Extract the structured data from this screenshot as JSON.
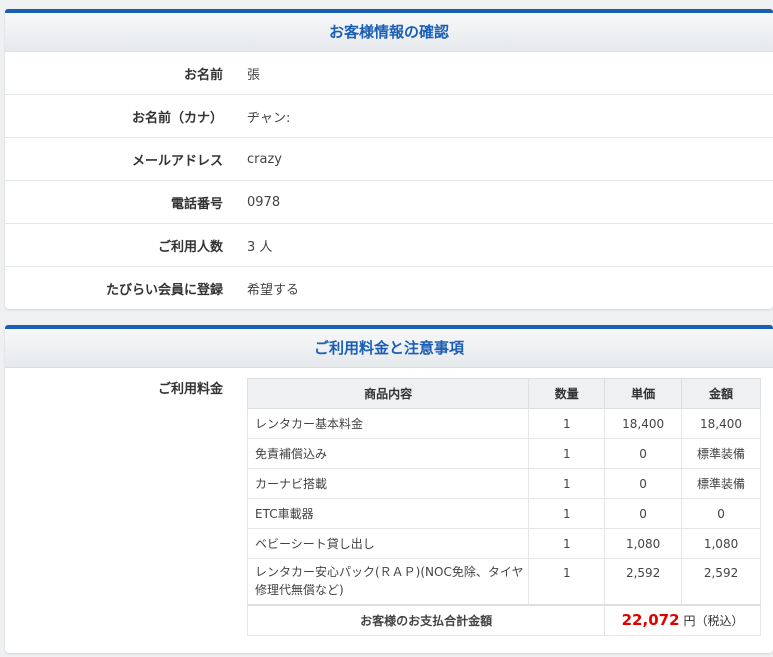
{
  "customer": {
    "title": "お客様情報の確認",
    "rows": [
      {
        "label": "お名前",
        "value": "張"
      },
      {
        "label": "お名前（カナ）",
        "value": "ヂャン:"
      },
      {
        "label": "メールアドレス",
        "value": "crazy"
      },
      {
        "label": "電話番号",
        "value": "0978"
      },
      {
        "label": "ご利用人数",
        "value": "3 人"
      },
      {
        "label": "たびらい会員に登録",
        "value": "希望する"
      }
    ]
  },
  "fees": {
    "title": "ご利用料金と注意事項",
    "label": "ご利用料金",
    "headers": {
      "item": "商品内容",
      "qty": "数量",
      "unit": "単価",
      "amount": "金額"
    },
    "items": [
      {
        "name": "レンタカー基本料金",
        "qty": "1",
        "unit": "18,400",
        "amount": "18,400"
      },
      {
        "name": "免責補償込み",
        "qty": "1",
        "unit": "0",
        "amount": "標準装備"
      },
      {
        "name": "カーナビ搭載",
        "qty": "1",
        "unit": "0",
        "amount": "標準装備"
      },
      {
        "name": "ETC車載器",
        "qty": "1",
        "unit": "0",
        "amount": "0"
      },
      {
        "name": "ベビーシート貸し出し",
        "qty": "1",
        "unit": "1,080",
        "amount": "1,080"
      },
      {
        "name": "レンタカー安心パック(ＲＡＰ)(NOC免除、タイヤ修理代無償など)",
        "qty": "1",
        "unit": "2,592",
        "amount": "2,592"
      }
    ],
    "total_label": "お客様のお支払合計金額",
    "total_value": "22,072",
    "total_unit": "円（税込）"
  }
}
